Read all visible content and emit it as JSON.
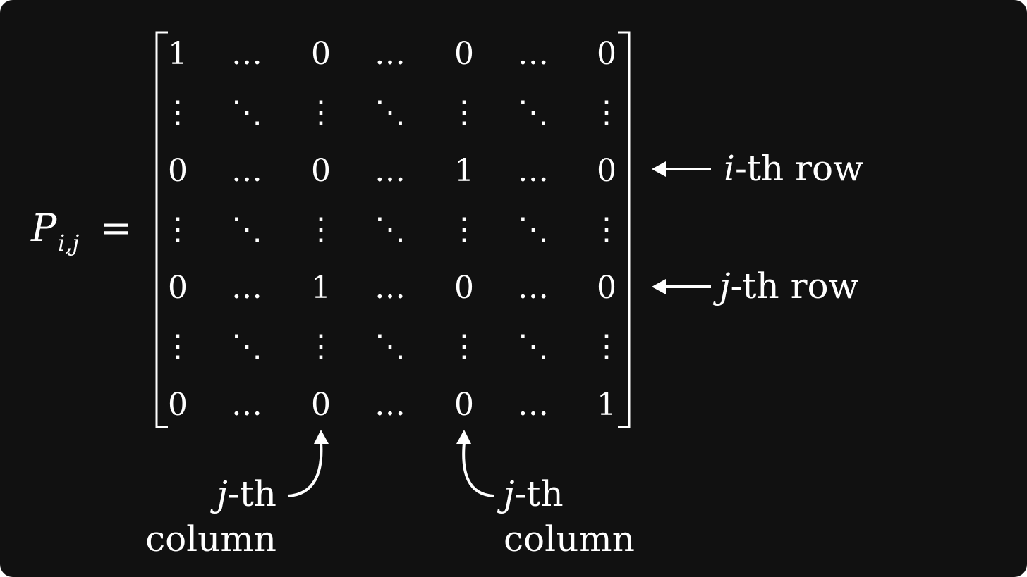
{
  "colors": {
    "background": "#111111",
    "foreground": "#ffffff"
  },
  "lhs": {
    "symbol": "P",
    "subscript": "i,j",
    "equals": "="
  },
  "matrix": {
    "rows": [
      [
        "1",
        "…",
        "0",
        "…",
        "0",
        "…",
        "0"
      ],
      [
        "⋮",
        "⋱",
        "⋮",
        "⋱",
        "⋮",
        "⋱",
        "⋮"
      ],
      [
        "0",
        "…",
        "0",
        "…",
        "1",
        "…",
        "0"
      ],
      [
        "⋮",
        "⋱",
        "⋮",
        "⋱",
        "⋮",
        "⋱",
        "⋮"
      ],
      [
        "0",
        "…",
        "1",
        "…",
        "0",
        "…",
        "0"
      ],
      [
        "⋮",
        "⋱",
        "⋮",
        "⋱",
        "⋮",
        "⋱",
        "⋮"
      ],
      [
        "0",
        "…",
        "0",
        "…",
        "0",
        "…",
        "1"
      ]
    ]
  },
  "row_labels": [
    {
      "var": "i",
      "suffix": "-th row"
    },
    {
      "var": "j",
      "suffix": "-th row"
    }
  ],
  "column_labels": [
    {
      "var": "j",
      "suffix": "-th",
      "second_line": "column"
    },
    {
      "var": "j",
      "suffix": "-th",
      "second_line": "column"
    }
  ]
}
